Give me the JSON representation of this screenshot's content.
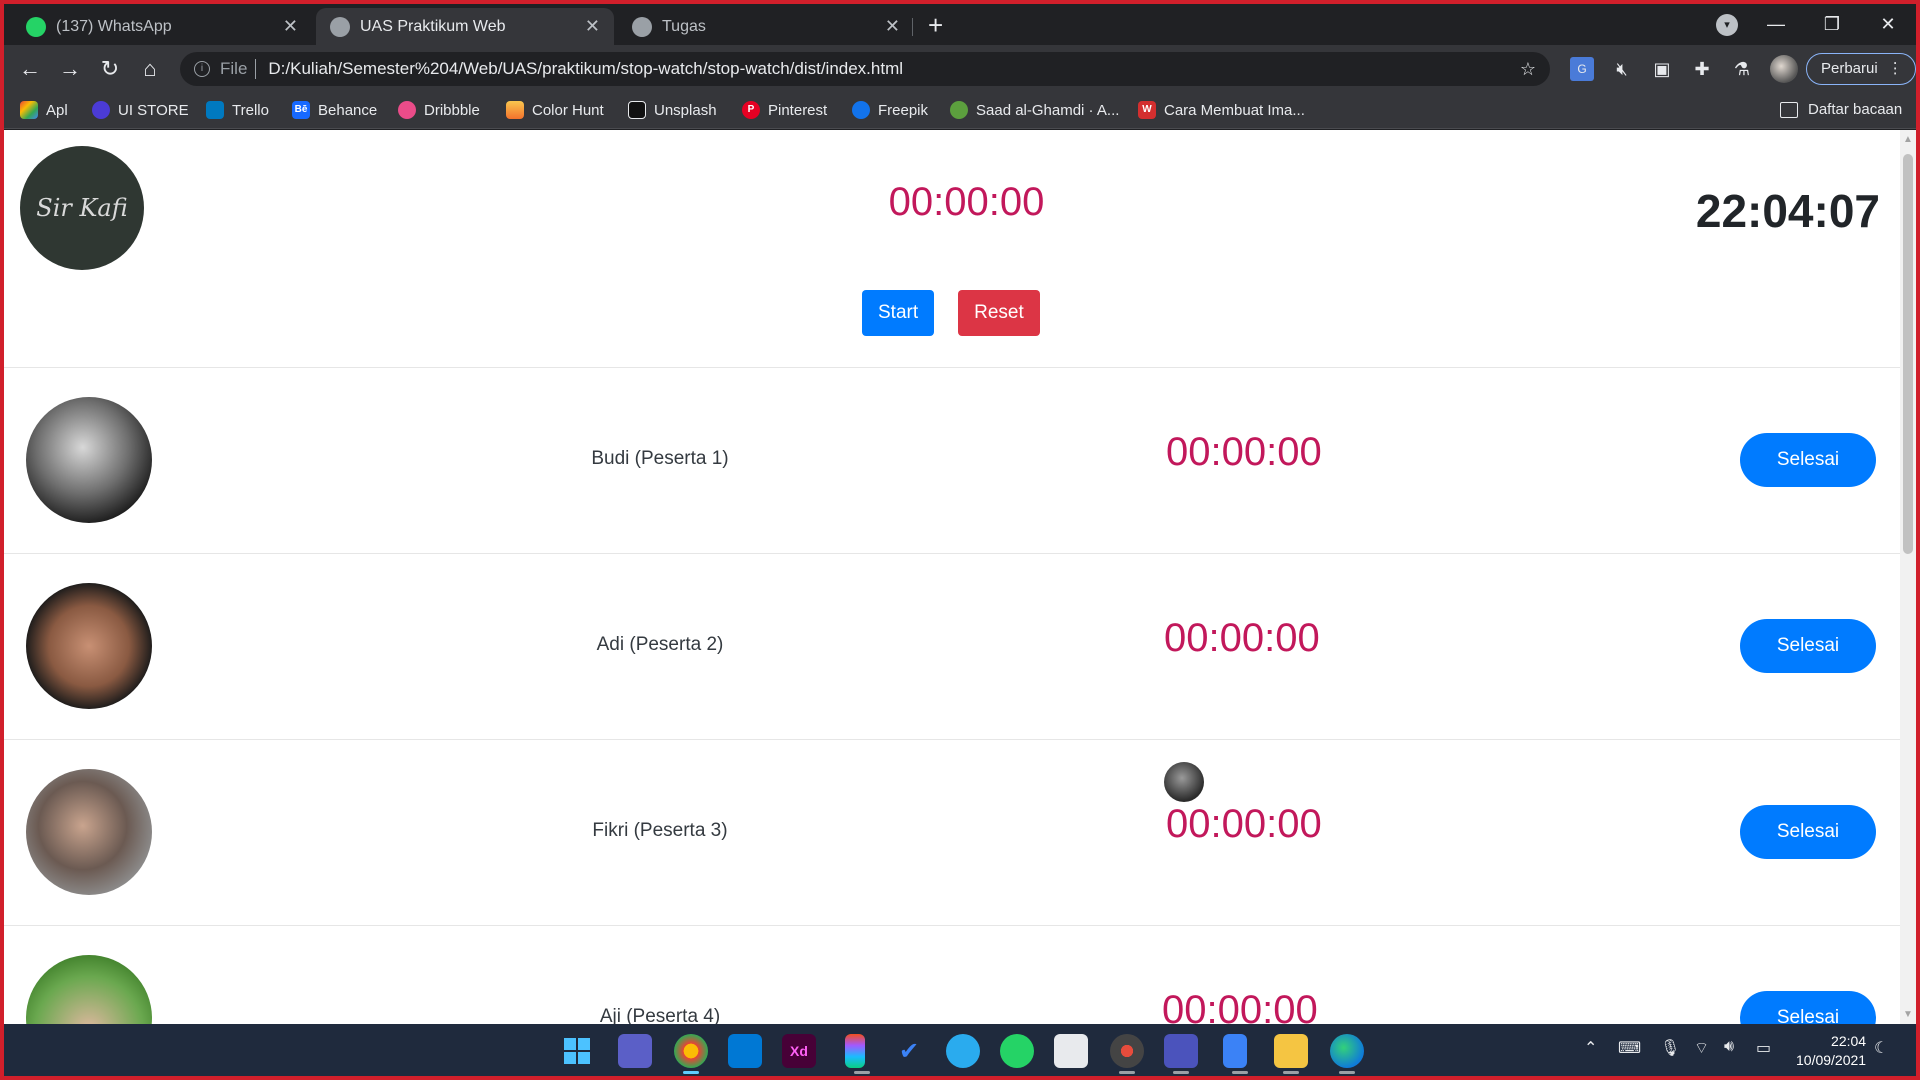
{
  "browser": {
    "tabs": [
      {
        "title": "(137) WhatsApp",
        "icon": "whatsapp-icon",
        "active": false
      },
      {
        "title": "UAS Praktikum Web",
        "icon": "globe-icon",
        "active": true
      },
      {
        "title": "Tugas",
        "icon": "globe-icon",
        "active": false
      }
    ],
    "address": {
      "scheme": "File",
      "url": "D:/Kuliah/Semester%204/Web/UAS/praktikum/stop-watch/stop-watch/dist/index.html"
    },
    "update_label": "Perbarui",
    "bookmarks": [
      {
        "label": "Apl",
        "icon": "apps-grid-icon"
      },
      {
        "label": "UI STORE",
        "icon": "ui-store-icon"
      },
      {
        "label": "Trello",
        "icon": "trello-icon"
      },
      {
        "label": "Behance",
        "icon": "behance-icon"
      },
      {
        "label": "Dribbble",
        "icon": "dribbble-icon"
      },
      {
        "label": "Color Hunt",
        "icon": "color-hunt-icon"
      },
      {
        "label": "Unsplash",
        "icon": "unsplash-icon"
      },
      {
        "label": "Pinterest",
        "icon": "pinterest-icon"
      },
      {
        "label": "Freepik",
        "icon": "freepik-icon"
      },
      {
        "label": "Saad al-Ghamdi · A...",
        "icon": "globe-icon"
      },
      {
        "label": "Cara Membuat Ima...",
        "icon": "wps-icon"
      }
    ],
    "reading_list": "Daftar bacaan"
  },
  "page": {
    "logo_text": "Sir Kafi",
    "main_timer": "00:00:00",
    "clock": "22:04:07",
    "start_label": "Start",
    "reset_label": "Reset",
    "participants": [
      {
        "name": "Budi (Peserta 1)",
        "timer": "00:00:00",
        "button": "Selesai"
      },
      {
        "name": "Adi (Peserta 2)",
        "timer": "00:00:00",
        "button": "Selesai"
      },
      {
        "name": "Fikri (Peserta 3)",
        "timer": "00:00:00",
        "button": "Selesai"
      },
      {
        "name": "Aji (Peserta 4)",
        "timer": "00:00:00",
        "button": "Selesai"
      }
    ]
  },
  "taskbar": {
    "time": "22:04",
    "date": "10/09/2021"
  },
  "colors": {
    "frame": "#d11f2b",
    "timer": "#c2185b",
    "primary": "#007bff",
    "danger": "#dc3545"
  }
}
